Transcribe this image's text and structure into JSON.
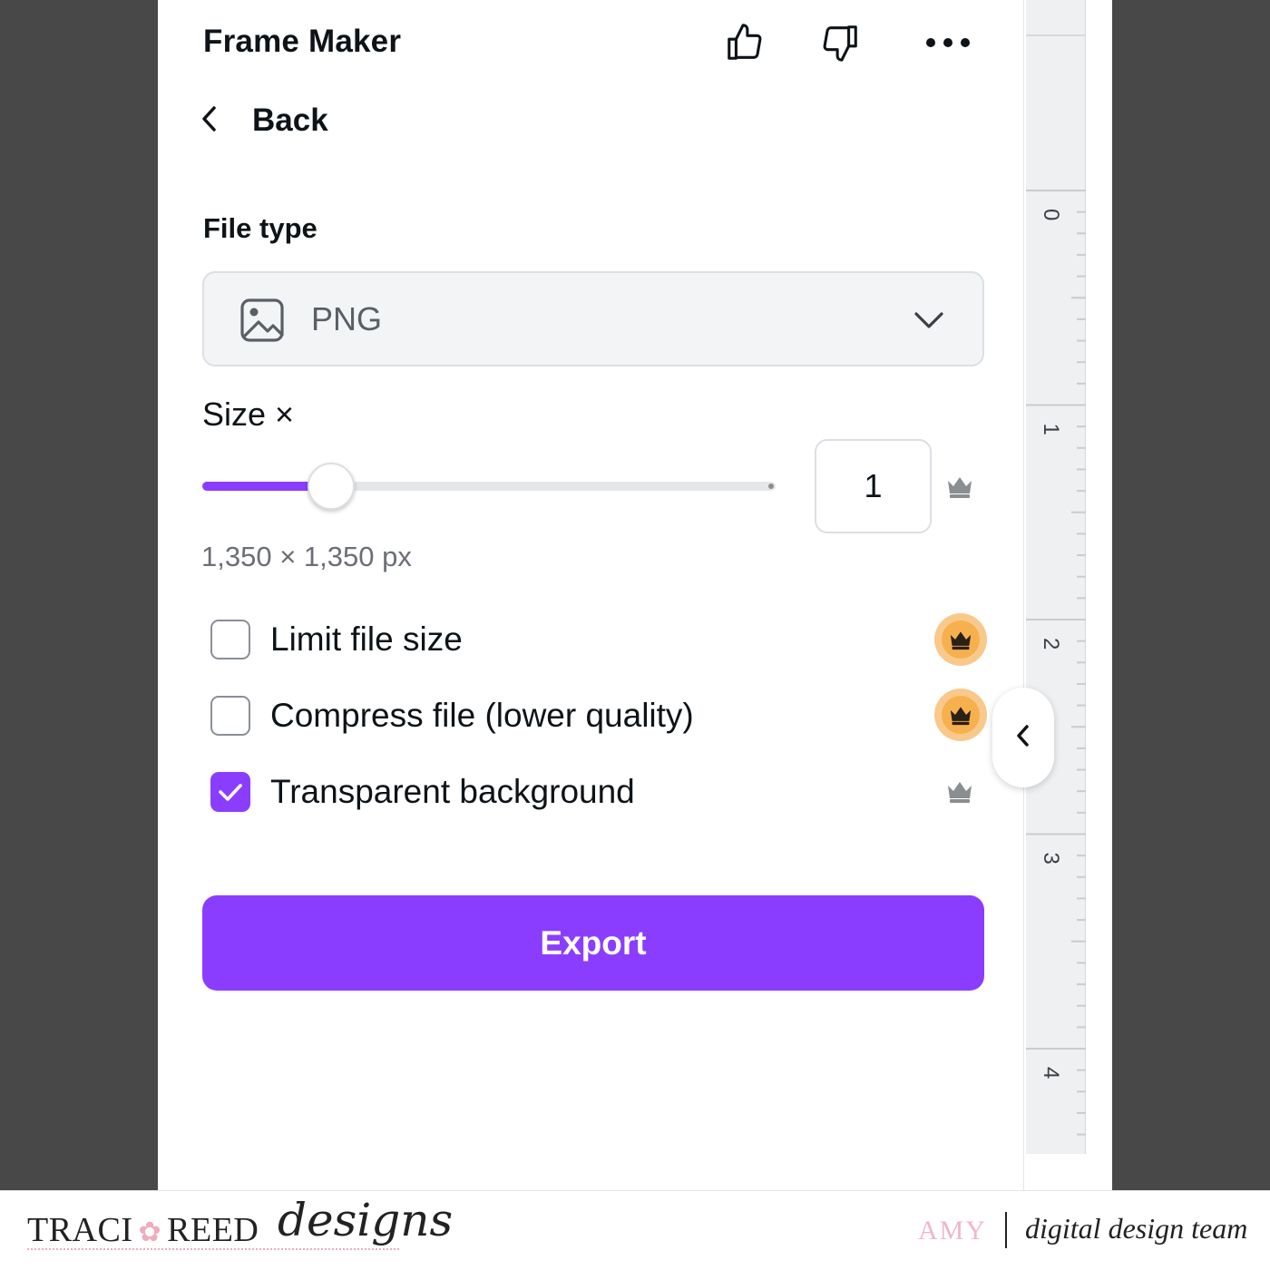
{
  "panel": {
    "title": "Frame Maker",
    "icons": [
      "thumbs-up-icon",
      "thumbs-down-icon",
      "more-icon"
    ],
    "back_label": "Back"
  },
  "file_type": {
    "label": "File type",
    "selected": "PNG",
    "icon": "image-icon"
  },
  "size": {
    "label": "Size ×",
    "value": "1",
    "slider_fraction": 0.2,
    "dimensions": "1,350 × 1,350 px"
  },
  "options": [
    {
      "label": "Limit file size",
      "checked": false,
      "premium_badge": true
    },
    {
      "label": "Compress file (lower quality)",
      "checked": false,
      "premium_badge": true
    },
    {
      "label": "Transparent background",
      "checked": true,
      "premium_badge": false
    }
  ],
  "export_label": "Export",
  "ruler": {
    "labels": [
      "0",
      "1",
      "2",
      "3",
      "4"
    ]
  },
  "footer": {
    "brand_left": "TRACI",
    "brand_mid": "REED",
    "brand_script": "designs",
    "author": "AMY",
    "team": "digital design team"
  },
  "colors": {
    "accent": "#8b3dff",
    "premium": "#f6b04e",
    "background": "#484848"
  }
}
